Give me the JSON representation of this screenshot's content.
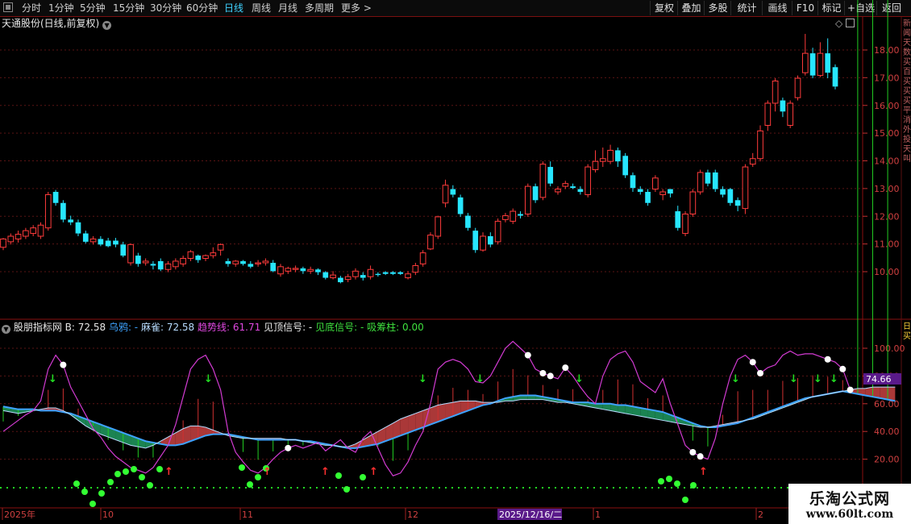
{
  "toolbar": {
    "periods": [
      "分时",
      "1分钟",
      "5分钟",
      "15分钟",
      "30分钟",
      "60分钟",
      "日线",
      "周线",
      "月线",
      "多周期",
      "更多 >"
    ],
    "active_period": "日线",
    "right_buttons": [
      "复权",
      "叠加",
      "多股",
      "统计",
      "画线",
      "F10",
      "标记",
      "+自选",
      "返回"
    ]
  },
  "main_panel": {
    "title": "天通股份(日线,前复权)",
    "price_ticks": [
      "18.00",
      "17.00",
      "16.00",
      "15.00",
      "14.00",
      "13.00",
      "12.00",
      "11.00",
      "10.00"
    ],
    "side_text": "新闻天数买百买买买平消外投天叫"
  },
  "indicator_panel": {
    "name": "股朋指标网",
    "b_label": "B: 72.58",
    "crow_label": "乌鸦: -",
    "sparrow_label": "麻雀: 72.58",
    "trend_label": "趋势线: 61.71",
    "top_signal_label": "见顶信号: -",
    "bottom_signal_label": "见底信号: -",
    "absorb_label": "吸筹柱: 0.00",
    "ticks": [
      "100.00",
      "80.00",
      "60.00",
      "40.00",
      "20.00"
    ],
    "current_value": "74.66",
    "side_text": "日买"
  },
  "date_axis": {
    "labels": [
      "2025年",
      "10",
      "11",
      "12",
      "1",
      "2"
    ],
    "highlight": "2025/12/16/二"
  },
  "watermark": {
    "title": "乐淘公式网",
    "url": "www.60lt.com"
  },
  "colors": {
    "up": "#ff3b3b",
    "down": "#27e6ff",
    "trend_line": "#3ea3ff",
    "sparrow_line": "#b8dcff",
    "kdj_line": "#d23bd2",
    "green_fill": "#1c8a56",
    "red_fill": "#b33b3b",
    "dot_line": "#22dd22",
    "bottom_dot": "#33ff33",
    "grid": "#5a1414"
  },
  "chart_data": {
    "type": "candlestick",
    "price_axis": {
      "ylim": [
        9.3,
        19.0
      ]
    },
    "candles": [
      [
        10.88,
        11.18,
        10.78,
        11.22
      ],
      [
        11.08,
        11.28,
        10.98,
        11.38
      ],
      [
        11.18,
        11.35,
        11.05,
        11.48
      ],
      [
        11.28,
        11.48,
        11.18,
        11.58
      ],
      [
        11.38,
        11.58,
        11.28,
        11.68
      ],
      [
        11.28,
        11.68,
        11.18,
        11.78
      ],
      [
        11.58,
        12.78,
        11.48,
        12.88
      ],
      [
        12.88,
        12.48,
        12.38,
        12.95
      ],
      [
        12.48,
        11.88,
        11.78,
        12.58
      ],
      [
        11.88,
        11.78,
        11.68,
        12.02
      ],
      [
        11.78,
        11.38,
        11.28,
        11.88
      ],
      [
        11.38,
        11.08,
        11.02,
        11.48
      ],
      [
        11.08,
        11.18,
        10.98,
        11.28
      ],
      [
        11.18,
        10.98,
        10.92,
        11.28
      ],
      [
        11.12,
        10.92,
        10.88,
        11.22
      ],
      [
        11.12,
        10.98,
        10.88,
        11.22
      ],
      [
        10.98,
        10.58,
        10.52,
        11.08
      ],
      [
        10.32,
        10.98,
        10.22,
        11.02
      ],
      [
        10.58,
        10.28,
        10.18,
        10.68
      ],
      [
        10.32,
        10.38,
        10.22,
        10.48
      ],
      [
        10.28,
        10.22,
        10.08,
        10.38
      ],
      [
        10.38,
        10.08,
        10.02,
        10.48
      ],
      [
        10.08,
        10.28,
        9.98,
        10.38
      ],
      [
        10.18,
        10.38,
        10.08,
        10.48
      ],
      [
        10.28,
        10.48,
        10.18,
        10.58
      ],
      [
        10.48,
        10.72,
        10.38,
        10.78
      ],
      [
        10.58,
        10.42,
        10.32,
        10.62
      ],
      [
        10.48,
        10.58,
        10.38,
        10.62
      ],
      [
        10.58,
        10.68,
        10.48,
        10.88
      ],
      [
        10.78,
        10.98,
        10.58,
        11.02
      ],
      [
        10.38,
        10.28,
        10.18,
        10.48
      ],
      [
        10.28,
        10.38,
        10.18,
        10.42
      ],
      [
        10.38,
        10.28,
        10.22,
        10.42
      ],
      [
        10.28,
        10.18,
        10.12,
        10.38
      ],
      [
        10.28,
        10.32,
        10.18,
        10.42
      ],
      [
        10.32,
        10.38,
        10.22,
        10.48
      ],
      [
        10.32,
        10.02,
        9.98,
        10.42
      ],
      [
        9.92,
        10.18,
        9.82,
        10.28
      ],
      [
        10.02,
        10.12,
        9.92,
        10.18
      ],
      [
        10.08,
        10.12,
        9.98,
        10.22
      ],
      [
        10.12,
        10.02,
        9.92,
        10.18
      ],
      [
        10.02,
        10.08,
        9.92,
        10.18
      ],
      [
        10.08,
        9.98,
        9.88,
        10.12
      ],
      [
        9.98,
        9.78,
        9.72,
        10.02
      ],
      [
        9.78,
        9.88,
        9.72,
        10.02
      ],
      [
        9.78,
        9.62,
        9.58,
        9.85
      ],
      [
        9.72,
        9.82,
        9.62,
        9.92
      ],
      [
        9.82,
        10.02,
        9.72,
        10.12
      ],
      [
        9.88,
        9.78,
        9.68,
        9.98
      ],
      [
        9.82,
        10.08,
        9.72,
        10.22
      ],
      [
        9.92,
        9.88,
        9.82,
        9.98
      ],
      [
        9.98,
        9.92,
        9.88,
        10.02
      ],
      [
        9.98,
        9.92,
        9.88,
        10.02
      ],
      [
        9.98,
        9.92,
        9.88,
        10.02
      ],
      [
        9.78,
        9.92,
        9.72,
        10.02
      ],
      [
        9.98,
        10.22,
        9.88,
        10.32
      ],
      [
        10.28,
        10.68,
        10.18,
        10.78
      ],
      [
        10.82,
        11.32,
        10.78,
        11.42
      ],
      [
        11.28,
        11.98,
        11.18,
        12.02
      ],
      [
        12.48,
        13.12,
        12.32,
        13.32
      ],
      [
        12.98,
        12.78,
        12.68,
        13.12
      ],
      [
        12.68,
        12.08,
        11.98,
        12.78
      ],
      [
        12.02,
        11.58,
        11.48,
        12.12
      ],
      [
        11.48,
        10.78,
        10.68,
        11.58
      ],
      [
        10.78,
        11.28,
        10.72,
        11.42
      ],
      [
        11.28,
        10.98,
        10.88,
        11.42
      ],
      [
        11.08,
        11.82,
        10.98,
        11.92
      ],
      [
        11.88,
        12.02,
        11.78,
        12.12
      ],
      [
        11.82,
        12.18,
        11.72,
        12.28
      ],
      [
        12.08,
        12.02,
        11.92,
        12.18
      ],
      [
        12.08,
        13.08,
        11.98,
        13.18
      ],
      [
        13.08,
        12.58,
        12.48,
        13.18
      ],
      [
        12.68,
        13.88,
        12.58,
        13.98
      ],
      [
        13.78,
        13.18,
        13.08,
        13.98
      ],
      [
        12.88,
        12.98,
        12.78,
        13.08
      ],
      [
        13.08,
        13.18,
        12.98,
        13.28
      ],
      [
        13.08,
        13.02,
        12.98,
        13.18
      ],
      [
        12.98,
        12.88,
        12.78,
        13.08
      ],
      [
        12.78,
        13.78,
        12.68,
        13.88
      ],
      [
        13.68,
        13.98,
        13.58,
        14.38
      ],
      [
        13.98,
        14.08,
        13.78,
        14.48
      ],
      [
        13.98,
        14.38,
        13.88,
        14.58
      ],
      [
        14.38,
        13.98,
        13.78,
        14.48
      ],
      [
        14.18,
        13.48,
        13.38,
        14.28
      ],
      [
        13.48,
        13.02,
        12.88,
        13.58
      ],
      [
        12.98,
        12.88,
        12.78,
        13.08
      ],
      [
        12.88,
        12.48,
        12.38,
        12.98
      ],
      [
        12.98,
        13.38,
        12.88,
        13.48
      ],
      [
        12.78,
        12.88,
        12.58,
        12.98
      ],
      [
        12.98,
        12.82,
        12.68,
        12.98
      ],
      [
        12.18,
        11.58,
        11.48,
        12.38
      ],
      [
        11.38,
        12.08,
        11.28,
        12.18
      ],
      [
        12.08,
        12.88,
        11.98,
        12.98
      ],
      [
        12.88,
        13.58,
        12.78,
        13.68
      ],
      [
        13.58,
        13.18,
        13.08,
        13.68
      ],
      [
        13.58,
        12.98,
        12.88,
        13.68
      ],
      [
        12.98,
        12.78,
        12.68,
        13.08
      ],
      [
        12.98,
        12.48,
        12.38,
        13.02
      ],
      [
        12.58,
        12.38,
        12.18,
        12.68
      ],
      [
        12.28,
        13.78,
        12.08,
        13.88
      ],
      [
        13.88,
        14.08,
        13.78,
        14.28
      ],
      [
        14.08,
        15.08,
        13.98,
        15.28
      ],
      [
        15.28,
        16.08,
        15.08,
        16.18
      ],
      [
        16.08,
        16.88,
        15.78,
        16.98
      ],
      [
        16.18,
        15.78,
        15.58,
        16.28
      ],
      [
        15.28,
        16.08,
        15.18,
        16.18
      ],
      [
        16.28,
        16.98,
        16.18,
        17.08
      ],
      [
        17.18,
        17.88,
        17.08,
        18.58
      ],
      [
        17.88,
        17.08,
        16.98,
        18.08
      ],
      [
        17.08,
        17.88,
        17.02,
        18.28
      ],
      [
        17.88,
        17.18,
        16.98,
        18.42
      ],
      [
        17.38,
        16.68,
        16.58,
        17.48
      ]
    ],
    "indicator_axis": {
      "ylim": [
        0,
        115
      ]
    },
    "kdj": [
      40,
      44,
      48,
      52,
      55,
      62,
      85,
      95,
      88,
      72,
      62,
      52,
      42,
      36,
      28,
      22,
      18,
      14,
      12,
      10,
      14,
      22,
      30,
      45,
      65,
      85,
      92,
      95,
      85,
      70,
      40,
      25,
      18,
      12,
      10,
      14,
      20,
      25,
      28,
      30,
      28,
      30,
      32,
      26,
      30,
      34,
      28,
      25,
      35,
      40,
      28,
      16,
      8,
      10,
      18,
      30,
      40,
      60,
      85,
      90,
      92,
      90,
      85,
      76,
      75,
      80,
      90,
      100,
      105,
      100,
      95,
      85,
      82,
      80,
      78,
      86,
      80,
      72,
      65,
      60,
      80,
      92,
      96,
      98,
      90,
      76,
      72,
      68,
      78,
      60,
      45,
      30,
      25,
      22,
      20,
      35,
      60,
      80,
      92,
      95,
      90,
      82,
      86,
      88,
      95,
      98,
      95,
      96,
      96,
      94,
      92,
      90,
      85,
      70
    ],
    "trend": [
      58,
      57,
      56,
      56,
      56,
      55,
      55,
      55,
      54,
      53,
      51,
      49,
      47,
      45,
      43,
      41,
      39,
      37,
      35,
      33,
      32,
      31,
      30,
      30,
      31,
      33,
      35,
      37,
      38,
      38,
      38,
      37,
      36,
      35,
      34,
      34,
      34,
      34,
      34,
      34,
      33,
      33,
      32,
      31,
      30,
      29,
      28,
      28,
      29,
      30,
      31,
      33,
      35,
      37,
      39,
      41,
      43,
      45,
      47,
      49,
      51,
      53,
      55,
      57,
      59,
      60,
      62,
      64,
      65,
      66,
      66,
      66,
      65,
      64,
      63,
      62,
      61,
      61,
      61,
      60,
      60,
      60,
      59,
      59,
      58,
      57,
      56,
      55,
      54,
      52,
      50,
      48,
      46,
      44,
      43,
      43,
      44,
      45,
      46,
      48,
      50,
      52,
      54,
      56,
      58,
      60,
      62,
      64,
      65,
      66,
      67,
      68,
      69,
      68,
      67,
      66,
      65,
      64,
      63,
      62
    ],
    "sparrow": [
      55,
      54,
      53,
      54,
      55,
      56,
      57,
      57,
      55,
      52,
      48,
      44,
      41,
      38,
      36,
      34,
      32,
      30,
      29,
      28,
      30,
      33,
      36,
      39,
      42,
      44,
      44,
      43,
      41,
      39,
      37,
      36,
      35,
      35,
      35,
      35,
      35,
      35,
      34,
      34,
      33,
      32,
      31,
      30,
      30,
      29,
      29,
      31,
      34,
      37,
      40,
      43,
      46,
      49,
      51,
      53,
      55,
      57,
      59,
      60,
      61,
      62,
      62,
      62,
      61,
      61,
      61,
      62,
      62,
      63,
      63,
      63,
      63,
      62,
      61,
      61,
      60,
      59,
      58,
      57,
      56,
      55,
      54,
      53,
      52,
      51,
      50,
      49,
      48,
      47,
      46,
      45,
      44,
      43,
      43,
      44,
      45,
      46,
      47,
      48,
      49,
      51,
      53,
      55,
      57,
      59,
      61,
      63,
      65,
      66,
      67,
      68,
      69,
      70,
      71,
      71,
      72,
      72,
      72,
      72
    ]
  }
}
